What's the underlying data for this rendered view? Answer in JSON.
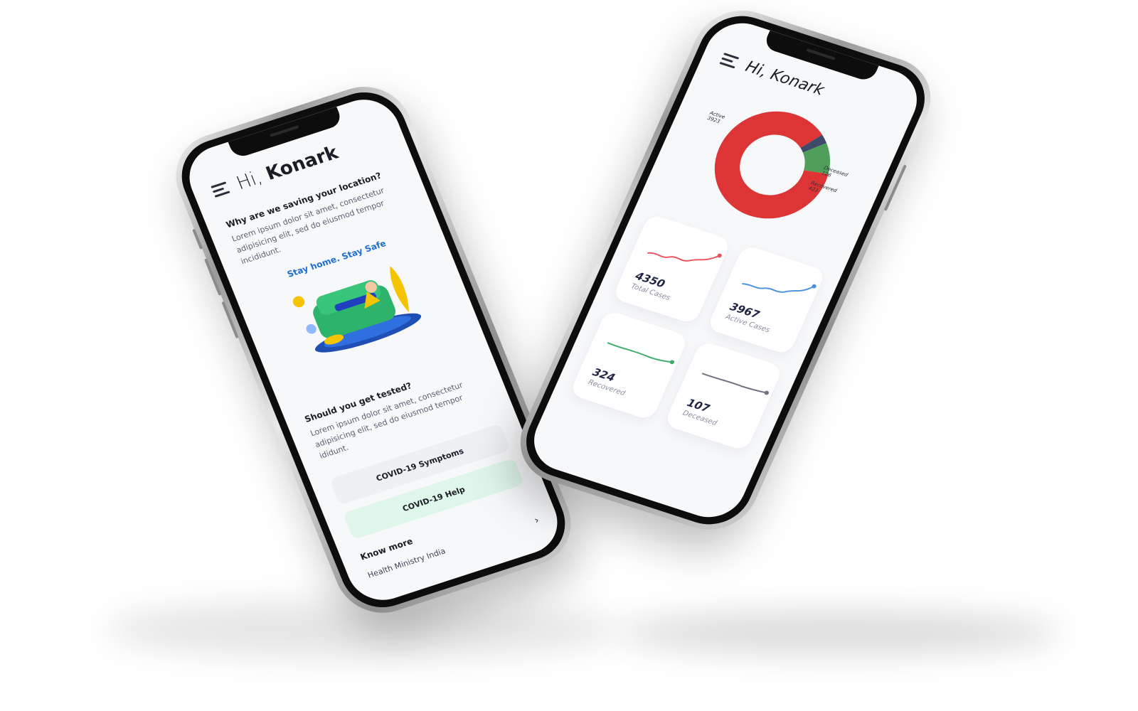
{
  "left_phone": {
    "greeting_hi": "Hi,",
    "greeting_name": "Konark",
    "section1": {
      "title": "Why are we saving your location?",
      "body": "Lorem ipsum dolor sit amet, consectetur adipisicing elit, sed do eiusmod tempor incididunt."
    },
    "illustration_caption": "Stay home. Stay Safe",
    "section2": {
      "title": "Should you get tested?",
      "body": "Lorem ipsum dolor sit amet, consectetur adipisicing elit, sed do eiusmod tempor ididunt."
    },
    "buttons": [
      "COVID-19 Symptoms",
      "COVID-19 Help"
    ],
    "know_more": {
      "title": "Know more",
      "link": "Health Ministry India"
    }
  },
  "right_phone": {
    "greeting_hi": "Hi,",
    "greeting_name": "Konark",
    "chart_data": {
      "type": "pie",
      "title": "",
      "slices": [
        {
          "name": "Active",
          "value": 3923,
          "color": "#dd3535"
        },
        {
          "name": "Deceased",
          "value": 126,
          "color": "#3f4a6b"
        },
        {
          "name": "Recovered",
          "value": 423,
          "color": "#4f9f5a"
        }
      ]
    },
    "stat_cards": [
      {
        "value": "4350",
        "label": "Total Cases",
        "color": "#e5545b"
      },
      {
        "value": "3967",
        "label": "Active Cases",
        "color": "#4a8fe0"
      },
      {
        "value": "324",
        "label": "Recovered",
        "color": "#3fae6a"
      },
      {
        "value": "107",
        "label": "Deceased",
        "color": "#6f7280"
      }
    ]
  }
}
